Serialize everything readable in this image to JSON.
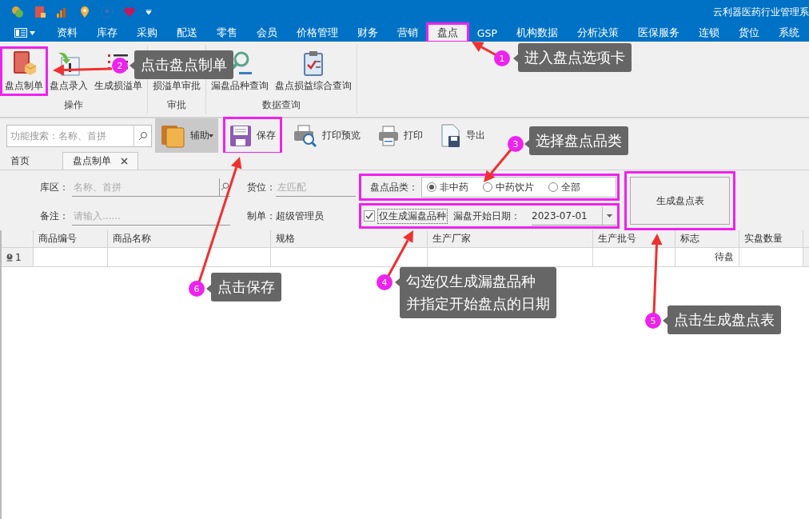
{
  "window": {
    "title": "云利器医药行业管理系"
  },
  "menu_tabs": [
    {
      "label": "资料",
      "selected": false
    },
    {
      "label": "库存",
      "selected": false
    },
    {
      "label": "采购",
      "selected": false
    },
    {
      "label": "配送",
      "selected": false
    },
    {
      "label": "零售",
      "selected": false
    },
    {
      "label": "会员",
      "selected": false
    },
    {
      "label": "价格管理",
      "selected": false
    },
    {
      "label": "财务",
      "selected": false
    },
    {
      "label": "营销",
      "selected": false
    },
    {
      "label": "盘点",
      "selected": true
    },
    {
      "label": "GSP",
      "selected": false
    },
    {
      "label": "机构数据",
      "selected": false
    },
    {
      "label": "分析决策",
      "selected": false
    },
    {
      "label": "医保服务",
      "selected": false
    },
    {
      "label": "连锁",
      "selected": false
    },
    {
      "label": "货位",
      "selected": false
    },
    {
      "label": "系统",
      "selected": false
    }
  ],
  "ribbon": {
    "groups": [
      {
        "title": "操作",
        "buttons": [
          "盘点制单",
          "盘点录入",
          "生成损溢单"
        ]
      },
      {
        "title": "审批",
        "buttons": [
          "损溢单审批"
        ]
      },
      {
        "title": "数据查询",
        "buttons": [
          "漏盘品种查询",
          "盘点损益综合查询"
        ]
      }
    ]
  },
  "toolbar": {
    "search": {
      "placeholder": "功能搜索：名称、首拼"
    },
    "buttons": [
      {
        "label": "辅助",
        "hovered": true,
        "dropdown": true
      },
      {
        "label": "保存",
        "hovered": false,
        "dropdown": false
      },
      {
        "label": "打印预览",
        "hovered": false,
        "dropdown": false
      },
      {
        "label": "打印",
        "hovered": false,
        "dropdown": false
      },
      {
        "label": "导出",
        "hovered": false,
        "dropdown": false
      }
    ]
  },
  "doc_tabs": [
    {
      "label": "首页",
      "selected": false,
      "closable": false
    },
    {
      "label": "盘点制单",
      "selected": true,
      "closable": true
    }
  ],
  "form": {
    "area": {
      "label": "库区：",
      "placeholder": "名称、首拼"
    },
    "location": {
      "label": "货位：",
      "placeholder": "左匹配"
    },
    "note": {
      "label": "备注：",
      "placeholder": "请输入......"
    },
    "creator": {
      "label": "制单：",
      "value": "超级管理员"
    },
    "category": {
      "label": "盘点品类：",
      "options": [
        {
          "label": "非中药",
          "selected": true
        },
        {
          "label": "中药饮片",
          "selected": false
        },
        {
          "label": "全部",
          "selected": false
        }
      ]
    },
    "missed_only": {
      "label": "仅生成漏盘品种",
      "checked": true
    },
    "start_date": {
      "label": "漏盘开始日期：",
      "value": "2023-07-01"
    },
    "generate_button": "生成盘点表"
  },
  "grid": {
    "columns": [
      "商品编号",
      "商品名称",
      "规格",
      "生产厂家",
      "生产批号",
      "标志",
      "实盘数量"
    ],
    "rows": [
      {
        "number": "1",
        "status": "待盘"
      }
    ]
  },
  "annotations": [
    {
      "number": "1",
      "lines": [
        "进入盘点选项卡"
      ]
    },
    {
      "number": "2",
      "lines": [
        "点击盘点制单"
      ]
    },
    {
      "number": "3",
      "lines": [
        "选择盘点品类"
      ]
    },
    {
      "number": "4",
      "lines": [
        "勾选仅生成漏盘品种",
        "并指定开始盘点的日期"
      ]
    },
    {
      "number": "5",
      "lines": [
        "点击生成盘点表"
      ]
    },
    {
      "number": "6",
      "lines": [
        "点击保存"
      ]
    }
  ]
}
